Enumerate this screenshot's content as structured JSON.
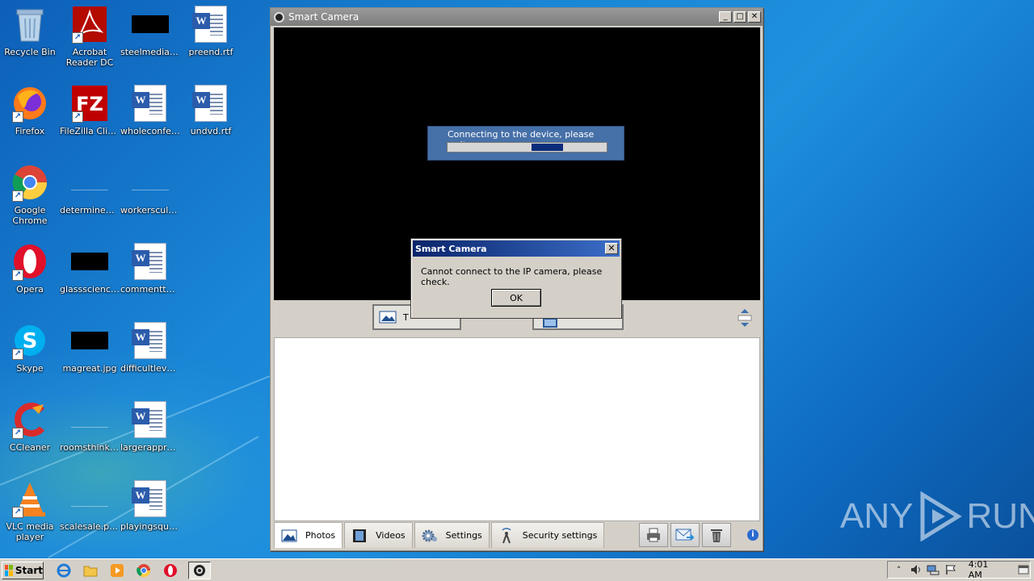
{
  "desktop": {
    "icons": [
      {
        "label": "Recycle Bin"
      },
      {
        "label": "Acrobat Reader DC"
      },
      {
        "label": "steelmedia.jpg"
      },
      {
        "label": "preend.rtf"
      },
      {
        "label": "Firefox"
      },
      {
        "label": "FileZilla Client"
      },
      {
        "label": "wholeconfer..."
      },
      {
        "label": "undvd.rtf"
      },
      {
        "label": "Google Chrome"
      },
      {
        "label": "determineb..."
      },
      {
        "label": "workerscult..."
      },
      {
        "label": "Opera"
      },
      {
        "label": "glassscience..."
      },
      {
        "label": "commentter..."
      },
      {
        "label": "Skype"
      },
      {
        "label": "magreat.jpg"
      },
      {
        "label": "difficultlevel..."
      },
      {
        "label": "CCleaner"
      },
      {
        "label": "roomsthinki..."
      },
      {
        "label": "largerappro..."
      },
      {
        "label": "VLC media player"
      },
      {
        "label": "scalesale.png"
      },
      {
        "label": "playingsqua..."
      }
    ]
  },
  "window": {
    "title": "Smart Camera",
    "connecting_text": "Connecting to the device, please wait...",
    "progress_fraction": 0.2,
    "progress_position": 0.53,
    "left_button_label": "T",
    "tabs": [
      {
        "label": "Photos"
      },
      {
        "label": "Videos"
      },
      {
        "label": "Settings"
      },
      {
        "label": "Security settings"
      }
    ],
    "info_label": "i"
  },
  "dialog": {
    "title": "Smart Camera",
    "message": "Cannot connect to the IP camera, please check.",
    "ok_label": "OK",
    "close_label": "✕"
  },
  "taskbar": {
    "start_label": "Start",
    "clock": "4:01 AM",
    "tray_chevron": "˄"
  },
  "watermark": {
    "left": "ANY",
    "right": "RUN"
  },
  "colors": {
    "dialog_title_start": "#0a246a",
    "dialog_title_end": "#3b6ec8",
    "progress_fill": "#0a2c7a",
    "connect_box": "#4670a8"
  }
}
